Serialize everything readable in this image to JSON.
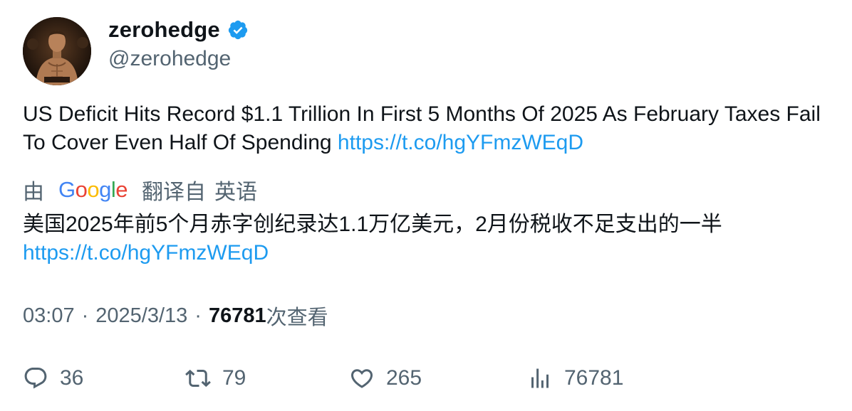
{
  "author": {
    "display_name": "zerohedge",
    "handle": "@zerohedge",
    "verified_icon": "verified-badge-icon",
    "verified_color": "#1d9bf0"
  },
  "tweet": {
    "text": "US Deficit Hits Record $1.1 Trillion In First 5 Months Of 2025 As February Taxes Fail To Cover Even Half Of Spending",
    "link": "https://t.co/hgYFmzWEqD"
  },
  "translation": {
    "by_label": "由",
    "provider": "Google",
    "translated_from_label": "翻译自",
    "source_language": "英语",
    "text": "美国2025年前5个月赤字创纪录达1.1万亿美元，2月份税收不足支出的一半",
    "link": "https://t.co/hgYFmzWEqD"
  },
  "meta": {
    "time": "03:07",
    "separator": "·",
    "date": "2025/3/13",
    "views_count": "76781",
    "views_label": "次查看"
  },
  "actions": {
    "reply": {
      "icon": "reply-icon",
      "count": "36"
    },
    "retweet": {
      "icon": "retweet-icon",
      "count": "79"
    },
    "like": {
      "icon": "heart-icon",
      "count": "265"
    },
    "views": {
      "icon": "analytics-icon",
      "count": "76781"
    }
  },
  "colors": {
    "link": "#1d9bf0",
    "secondary_text": "#536471",
    "primary_text": "#0f1419"
  }
}
